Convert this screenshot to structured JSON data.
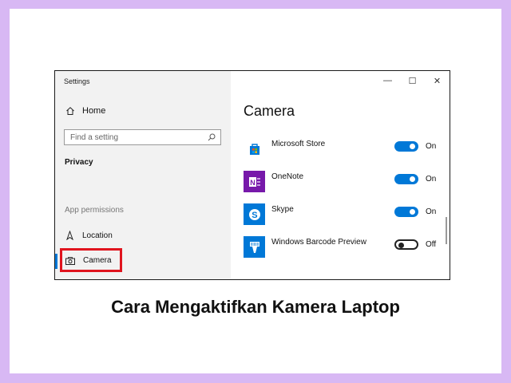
{
  "window": {
    "title": "Settings",
    "controls": {
      "minimize": "—",
      "maximize": "☐",
      "close": "✕"
    }
  },
  "sidebar": {
    "home_label": "Home",
    "search": {
      "placeholder": "Find a setting"
    },
    "group_label": "Privacy",
    "section_label": "App permissions",
    "items": [
      {
        "label": "Location",
        "icon": "location-icon"
      },
      {
        "label": "Camera",
        "icon": "camera-icon",
        "selected": true
      }
    ]
  },
  "main": {
    "title": "Camera",
    "apps": [
      {
        "name": "Microsoft Store",
        "icon": "microsoft-store-icon",
        "enabled": true,
        "state": "On",
        "icon_color": "#0078d7"
      },
      {
        "name": "OneNote",
        "icon": "onenote-icon",
        "enabled": true,
        "state": "On",
        "icon_color": "#7719aa"
      },
      {
        "name": "Skype",
        "icon": "skype-icon",
        "enabled": true,
        "state": "On",
        "icon_color": "#0078d7"
      },
      {
        "name": "Windows Barcode Preview",
        "icon": "barcode-scanner-icon",
        "enabled": false,
        "state": "Off",
        "icon_color": "#0078d7"
      }
    ]
  },
  "caption": "Cara Mengaktifkan Kamera Laptop",
  "colors": {
    "accent": "#0078d7",
    "highlight_box": "#e0141e",
    "page_background": "#d8b8f4"
  }
}
